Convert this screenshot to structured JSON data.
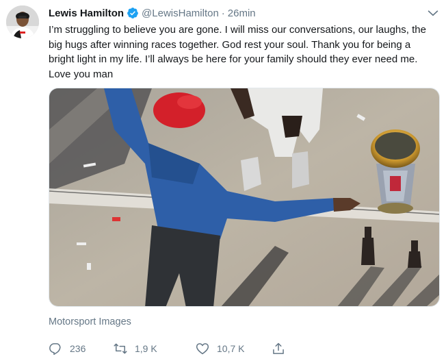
{
  "tweet": {
    "author_name": "Lewis Hamilton",
    "handle": "@LewisHamilton",
    "separator": "·",
    "time": "26min",
    "text": "I’m struggling to believe you are gone. I will miss our conversations, our laughs, the big hugs after winning races together. God rest your soul. Thank you for being a bright light in my life. I’ll always be here for your family should they ever need me. Love you man",
    "media_credit": "Motorsport Images"
  },
  "actions": {
    "replies": "236",
    "retweets": "1,9 K",
    "likes": "10,7 K"
  },
  "icons": {
    "verified": "verified-badge-icon",
    "caret": "chevron-down-icon",
    "reply": "reply-icon",
    "retweet": "retweet-icon",
    "like": "heart-icon",
    "share": "share-icon"
  },
  "colors": {
    "text_primary": "#14171a",
    "text_secondary": "#657786",
    "verified_blue": "#1da1f2"
  }
}
